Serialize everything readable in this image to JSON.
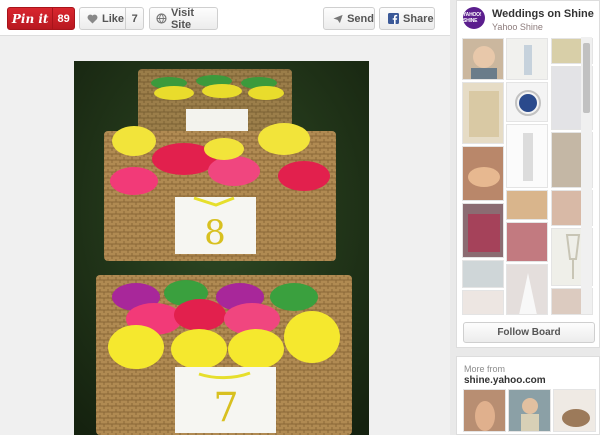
{
  "toolbar": {
    "pin_label": "Pin it",
    "pin_count": "89",
    "like_label": "Like",
    "like_count": "7",
    "visit_label": "Visit Site",
    "send_label": "Send",
    "share_label": "Share"
  },
  "photo": {
    "card_top": "8",
    "card_bottom": "7"
  },
  "board": {
    "avatar_text": "YAHOO! SHINE",
    "title": "Weddings on Shine",
    "subtitle": "Yahoo Shine",
    "follow_label": "Follow Board"
  },
  "more": {
    "label": "More from",
    "source": "shine.yahoo.com"
  },
  "icons": {
    "like": "heart-icon",
    "visit": "globe-icon",
    "send": "paper-plane-icon",
    "share": "facebook-icon"
  },
  "colors": {
    "pin_red": "#c8232c",
    "board_purple": "#5b1e8d"
  }
}
